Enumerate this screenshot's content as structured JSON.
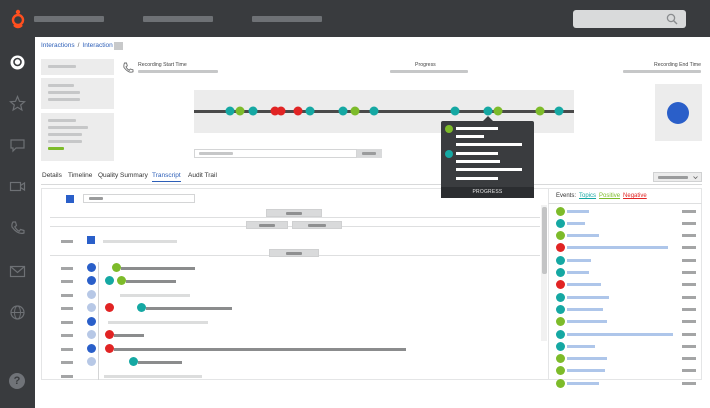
{
  "app": {
    "brand_icon": "genesys-logo-icon",
    "top_nav": [
      "",
      "",
      ""
    ],
    "search": {
      "icon": "search-icon",
      "placeholder": ""
    }
  },
  "side_nav": {
    "items": [
      {
        "icon": "agent-avatar-icon",
        "active": true
      },
      {
        "icon": "star-icon"
      },
      {
        "icon": "chat-bubble-icon"
      },
      {
        "icon": "video-camera-icon"
      },
      {
        "icon": "phone-icon"
      },
      {
        "icon": "envelope-icon"
      },
      {
        "icon": "globe-icon"
      }
    ],
    "help_label": "?"
  },
  "breadcrumb": {
    "root": "Interactions",
    "separator": "/",
    "current": "Interaction"
  },
  "recording": {
    "start_label": "Recording Start Time",
    "progress_label": "Progress",
    "end_label": "Recording End Time",
    "phone_icon": "phone-icon"
  },
  "colors": {
    "topic": "#15a8a3",
    "positive": "#7dbb2a",
    "negative": "#e12424",
    "speaker": "#2a5fc9",
    "other_speaker": "#b7c8e6",
    "brand_accent": "#7dbb2a"
  },
  "timeline_events": [
    {
      "kind": "topic"
    },
    {
      "kind": "positive"
    },
    {
      "kind": "topic"
    },
    {
      "kind": "negative"
    },
    {
      "kind": "negative"
    },
    {
      "kind": "negative"
    },
    {
      "kind": "topic"
    },
    {
      "kind": "topic"
    },
    {
      "kind": "positive"
    },
    {
      "kind": "topic"
    },
    {
      "kind": "topic"
    },
    {
      "kind": "topic"
    },
    {
      "kind": "positive"
    },
    {
      "kind": "positive"
    },
    {
      "kind": "topic"
    },
    {
      "kind": "positive"
    }
  ],
  "tooltip": {
    "footer": "PROGRESS",
    "entries": [
      {
        "kind": "positive"
      },
      {
        "kind": "topic"
      }
    ]
  },
  "tabs": [
    {
      "label": "Details"
    },
    {
      "label": "Timeline"
    },
    {
      "label": "Quality Summary"
    },
    {
      "label": "Transcript",
      "active": true
    },
    {
      "label": "Audit Trail"
    }
  ],
  "transcript": {
    "lines": [
      {
        "speaker": "speaker",
        "tags": [
          "positive"
        ]
      },
      {
        "speaker": "speaker",
        "tags": [
          "topic",
          "positive"
        ]
      },
      {
        "speaker": "other_speaker",
        "tags": []
      },
      {
        "speaker": "other_speaker",
        "tags": [
          "negative",
          "topic"
        ]
      },
      {
        "speaker": "speaker",
        "tags": []
      },
      {
        "speaker": "other_speaker",
        "tags": [
          "negative"
        ]
      },
      {
        "speaker": "speaker",
        "tags": [
          "negative"
        ]
      },
      {
        "speaker": "other_speaker",
        "tags": [
          "topic"
        ]
      }
    ]
  },
  "events_panel": {
    "label": "Events:",
    "filters": {
      "topics": "Topics",
      "positive": "Positive",
      "negative": "Negative"
    },
    "items": [
      {
        "kind": "positive"
      },
      {
        "kind": "topic"
      },
      {
        "kind": "positive"
      },
      {
        "kind": "negative"
      },
      {
        "kind": "topic"
      },
      {
        "kind": "topic"
      },
      {
        "kind": "negative"
      },
      {
        "kind": "topic"
      },
      {
        "kind": "topic"
      },
      {
        "kind": "positive"
      },
      {
        "kind": "topic"
      },
      {
        "kind": "topic"
      },
      {
        "kind": "positive"
      },
      {
        "kind": "positive"
      },
      {
        "kind": "positive"
      }
    ]
  }
}
